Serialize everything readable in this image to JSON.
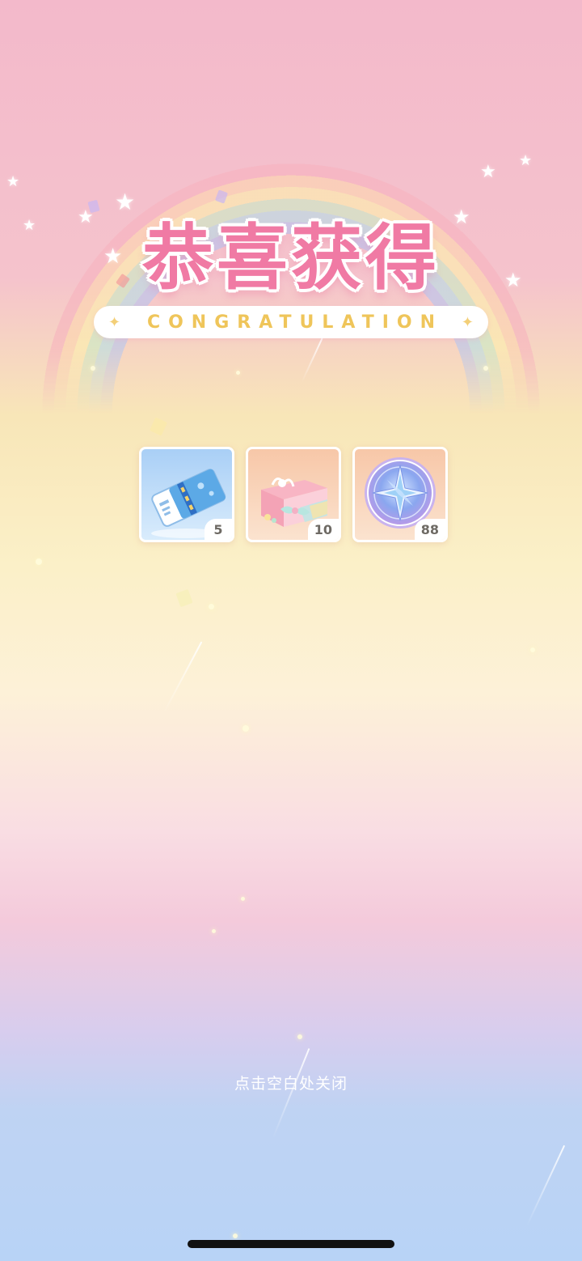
{
  "header": {
    "title": "恭喜获得",
    "subtitle": "CONGRATULATION"
  },
  "rewards": [
    {
      "name": "ticket",
      "count": "5",
      "icon": "ticket-icon"
    },
    {
      "name": "gift-box",
      "count": "10",
      "icon": "gift-box-icon"
    },
    {
      "name": "star-coin",
      "count": "88",
      "icon": "compass-coin-icon"
    }
  ],
  "footer": {
    "close_hint": "点击空白处关闭"
  },
  "colors": {
    "title": "#f07aa4",
    "subtitle": "#efc55a",
    "count_text": "#6e6a64"
  }
}
